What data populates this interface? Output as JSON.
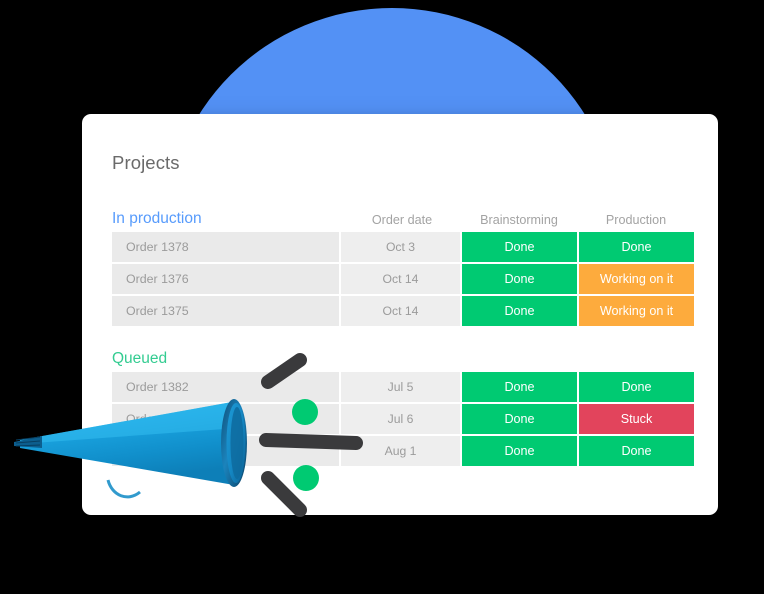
{
  "card": {
    "title": "Projects"
  },
  "columns": {
    "name": "",
    "date": "Order date",
    "brainstorming": "Brainstorming",
    "production": "Production"
  },
  "colors": {
    "accent_blue": "#579bfc",
    "accent_green": "#33cc91",
    "status_done": "#00ca72",
    "status_working": "#fdab3d",
    "status_stuck": "#e2445c",
    "backdrop_circle": "#5391f5",
    "megaphone": "#19a3dd",
    "row_bg": "#eaeaea",
    "card_bg": "#ffffff",
    "page_bg": "#000000"
  },
  "groups": [
    {
      "label": "In production",
      "color": "#579bfc",
      "rows": [
        {
          "name": "Order 1378",
          "date": "Oct 3",
          "brainstorming": "Done",
          "brainstorming_state": "done",
          "production": "Done",
          "production_state": "done"
        },
        {
          "name": "Order 1376",
          "date": "Oct 14",
          "brainstorming": "Done",
          "brainstorming_state": "done",
          "production": "Working on it",
          "production_state": "working"
        },
        {
          "name": "Order 1375",
          "date": "Oct 14",
          "brainstorming": "Done",
          "brainstorming_state": "done",
          "production": "Working on it",
          "production_state": "working"
        }
      ]
    },
    {
      "label": "Queued",
      "color": "#33cc91",
      "rows": [
        {
          "name": "Order 1382",
          "date": "Jul 5",
          "brainstorming": "Done",
          "brainstorming_state": "done",
          "production": "Done",
          "production_state": "done"
        },
        {
          "name": "Order 1",
          "date": "Jul 6",
          "brainstorming": "Done",
          "brainstorming_state": "done",
          "production": "Stuck",
          "production_state": "stuck"
        },
        {
          "name": "",
          "date": "Aug 1",
          "brainstorming": "Done",
          "brainstorming_state": "done",
          "production": "Done",
          "production_state": "done"
        }
      ]
    }
  ],
  "illustration": {
    "name": "megaphone-illustration",
    "description": "blue megaphone with motion dashes and green dots"
  }
}
